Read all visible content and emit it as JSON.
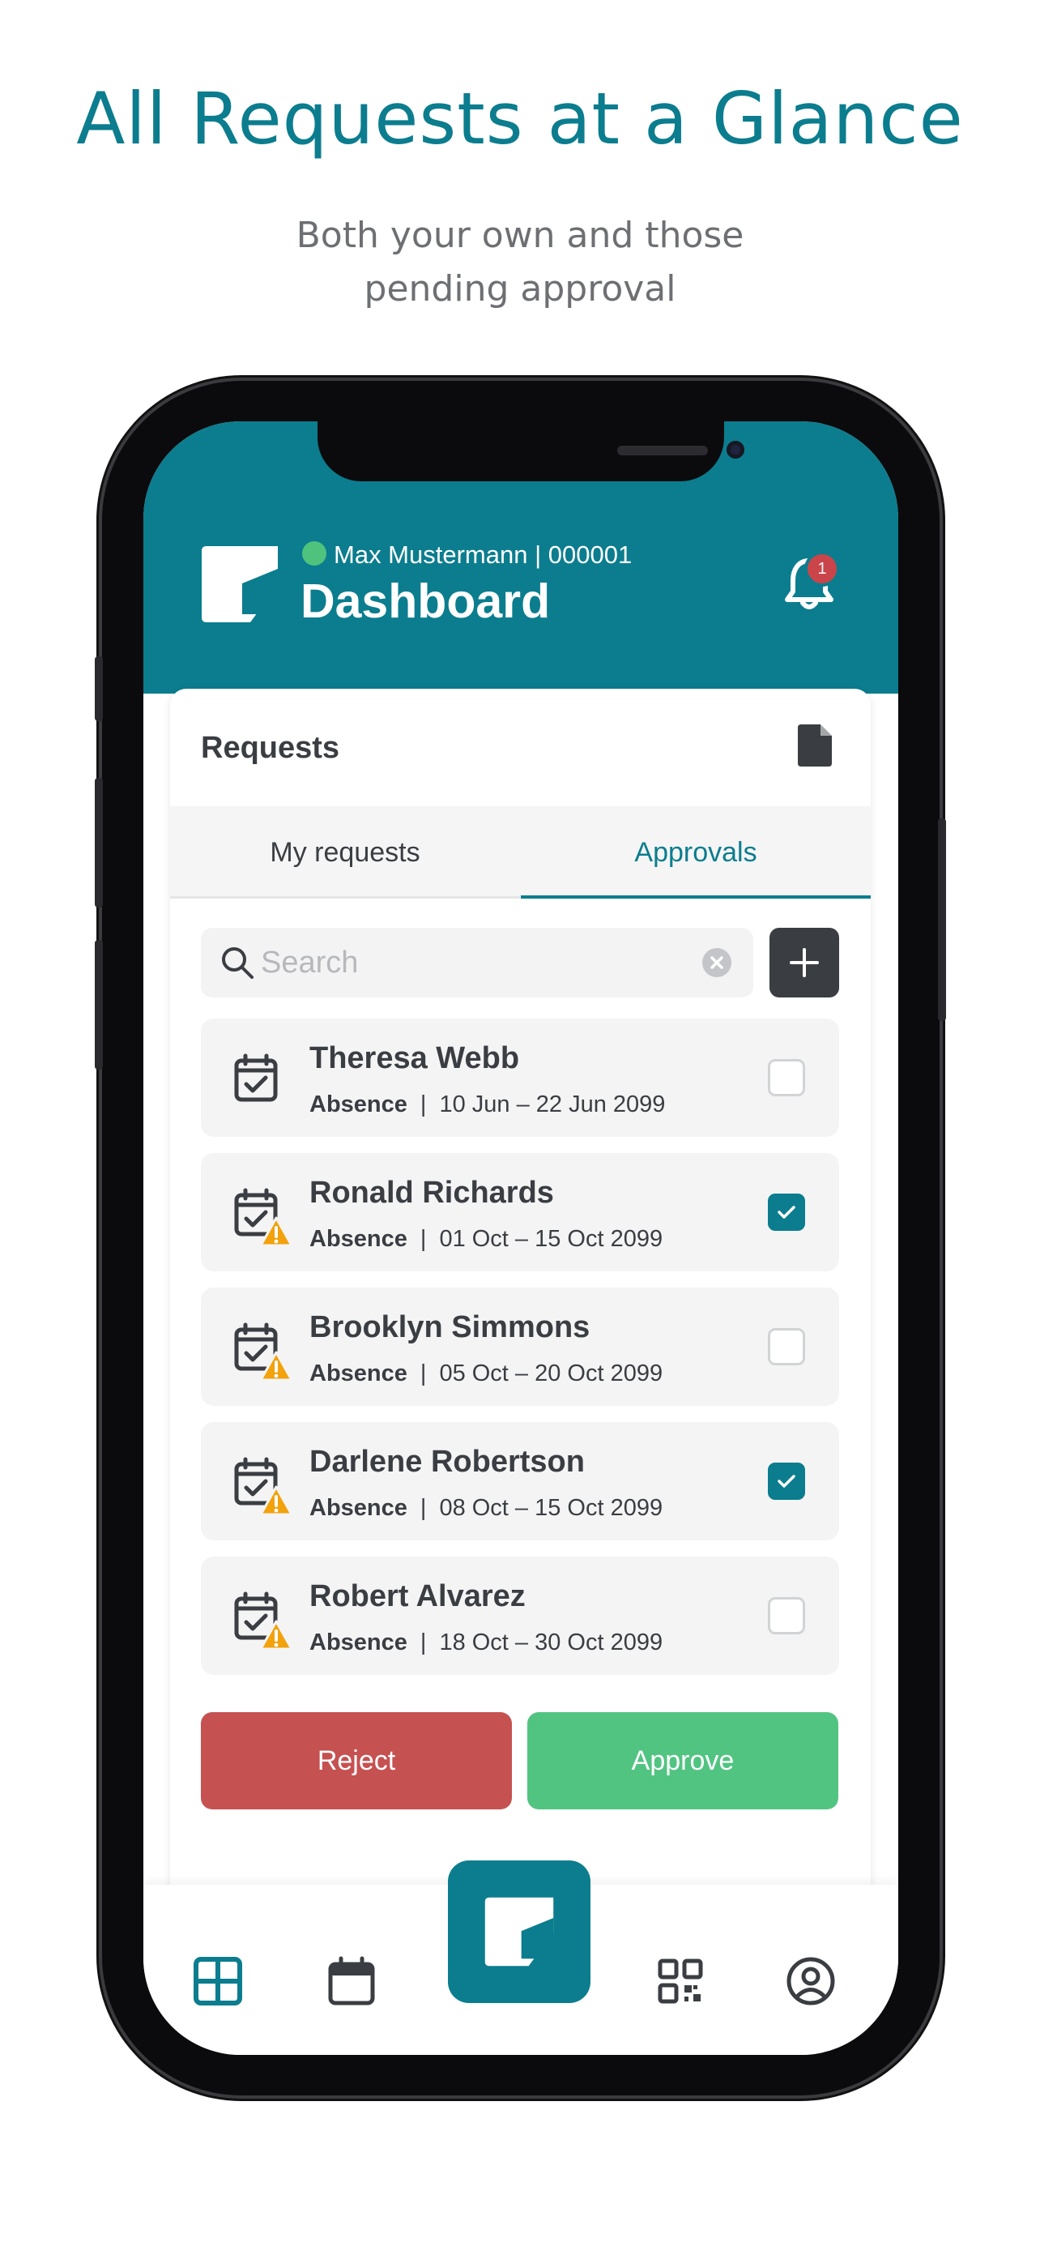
{
  "promo": {
    "title": "All Requests at a Glance",
    "subtitle": "Both your own and those pending approval"
  },
  "header": {
    "user": "Max Mustermann | 000001",
    "title": "Dashboard",
    "notification_count": "1",
    "status_color": "#4fc37d",
    "brand_color": "#0b7d8e"
  },
  "requests": {
    "title": "Requests",
    "tabs": [
      {
        "label": "My requests",
        "active": false
      },
      {
        "label": "Approvals",
        "active": true
      }
    ],
    "search_placeholder": "Search",
    "search_value": "",
    "items": [
      {
        "name": "Theresa Webb",
        "type": "Absence",
        "dates": "10 Jun – 22 Jun 2099",
        "warning": false,
        "checked": false
      },
      {
        "name": "Ronald Richards",
        "type": "Absence",
        "dates": "01 Oct – 15 Oct 2099",
        "warning": true,
        "checked": true
      },
      {
        "name": "Brooklyn Simmons",
        "type": "Absence",
        "dates": "05 Oct – 20 Oct 2099",
        "warning": true,
        "checked": false
      },
      {
        "name": "Darlene Robertson",
        "type": "Absence",
        "dates": "08 Oct – 15 Oct 2099",
        "warning": true,
        "checked": true
      },
      {
        "name": "Robert Alvarez",
        "type": "Absence",
        "dates": "18 Oct – 30 Oct 2099",
        "warning": true,
        "checked": false
      }
    ],
    "separator": "|",
    "reject_label": "Reject",
    "approve_label": "Approve",
    "reject_color": "#c65151",
    "approve_color": "#52c482"
  },
  "nav": {
    "items": [
      "dashboard-icon",
      "calendar-icon",
      "app-logo-icon",
      "qr-code-icon",
      "profile-icon"
    ],
    "active": "dashboard-icon"
  }
}
